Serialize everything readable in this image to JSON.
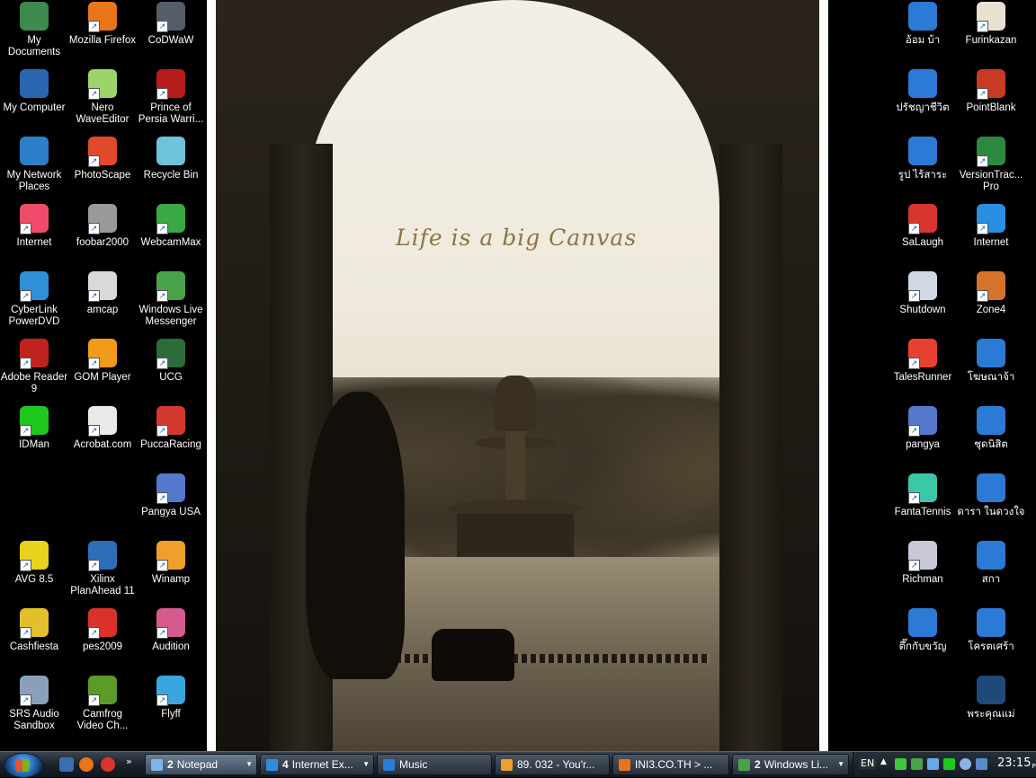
{
  "wallpaper": {
    "caption": "Life is a big Canvas"
  },
  "left_icons": [
    {
      "label": "My Documents",
      "icon": "folder-documents-icon",
      "color": "#3d8a4e"
    },
    {
      "label": "Mozilla Firefox",
      "icon": "firefox-icon",
      "color": "#e8751a"
    },
    {
      "label": "CoDWaW",
      "icon": "codwaw-icon",
      "color": "#555e68"
    },
    {
      "label": "My Computer",
      "icon": "computer-icon",
      "color": "#2a66b0"
    },
    {
      "label": "Nero WaveEditor",
      "icon": "nero-icon",
      "color": "#9ed36a"
    },
    {
      "label": "Prince of Persia Warri...",
      "icon": "prince-of-persia-icon",
      "color": "#b71c1c"
    },
    {
      "label": "My Network Places",
      "icon": "network-icon",
      "color": "#2b7fc8"
    },
    {
      "label": "PhotoScape",
      "icon": "photoscape-icon",
      "color": "#e04a2b"
    },
    {
      "label": "Recycle Bin",
      "icon": "recycle-bin-icon",
      "color": "#6fc3d9"
    },
    {
      "label": "Internet",
      "icon": "hello-kitty-icon",
      "color": "#f04c6a"
    },
    {
      "label": "foobar2000",
      "icon": "foobar-icon",
      "color": "#999999"
    },
    {
      "label": "WebcamMax",
      "icon": "webcam-icon",
      "color": "#3aa843"
    },
    {
      "label": "CyberLink PowerDVD",
      "icon": "powerdvd-icon",
      "color": "#2f8fd8"
    },
    {
      "label": "amcap",
      "icon": "amcap-icon",
      "color": "#d9d9d9"
    },
    {
      "label": "Windows Live Messenger",
      "icon": "messenger-icon",
      "color": "#4aa34a"
    },
    {
      "label": "Adobe Reader 9",
      "icon": "adobe-reader-icon",
      "color": "#c0231e"
    },
    {
      "label": "GOM Player",
      "icon": "gom-player-icon",
      "color": "#f29a1a"
    },
    {
      "label": "UCG",
      "icon": "ucg-icon",
      "color": "#2e6b3a"
    },
    {
      "label": "IDMan",
      "icon": "idman-icon",
      "color": "#1ec81e"
    },
    {
      "label": "Acrobat.com",
      "icon": "acrobat-icon",
      "color": "#e9e9e9"
    },
    {
      "label": "PuccaRacing",
      "icon": "pucca-racing-icon",
      "color": "#d33a2e"
    },
    {
      "label": "Pangya USA",
      "icon": "pangya-usa-icon",
      "color": "#5577cc"
    },
    {
      "label": "AVG 8.5",
      "icon": "avg-icon",
      "color": "#e8d21e"
    },
    {
      "label": "Xilinx PlanAhead 11",
      "icon": "xilinx-icon",
      "color": "#2c6fb8"
    },
    {
      "label": "Winamp",
      "icon": "winamp-icon",
      "color": "#f0a02a"
    },
    {
      "label": "Cashfiesta",
      "icon": "cashfiesta-icon",
      "color": "#e3c02a"
    },
    {
      "label": "pes2009",
      "icon": "pes2009-icon",
      "color": "#d9322a"
    },
    {
      "label": "Audition",
      "icon": "audition-icon",
      "color": "#d55a90"
    },
    {
      "label": "SRS Audio Sandbox",
      "icon": "srs-audio-icon",
      "color": "#8aa0b8"
    },
    {
      "label": "Camfrog Video Ch...",
      "icon": "camfrog-icon",
      "color": "#5c9a2a"
    },
    {
      "label": "Flyff",
      "icon": "flyff-icon",
      "color": "#3aa6e0"
    }
  ],
  "right_icons": [
    {
      "label": "อ้อม บ้า",
      "icon": "folder-icon",
      "color": "#2b7ad6"
    },
    {
      "label": "Furinkazan",
      "icon": "furinkazan-icon",
      "color": "#e9e0d0"
    },
    {
      "label": "ปรัชญาชีวิต",
      "icon": "folder-icon",
      "color": "#2b7ad6"
    },
    {
      "label": "PointBlank",
      "icon": "pointblank-icon",
      "color": "#c83a22"
    },
    {
      "label": "รูป ไร้สาระ",
      "icon": "folder-icon",
      "color": "#2b7ad6"
    },
    {
      "label": "VersionTrac... Pro",
      "icon": "versiontracker-icon",
      "color": "#2c8a3e"
    },
    {
      "label": "SaLaugh",
      "icon": "salaugh-icon",
      "color": "#d8352e"
    },
    {
      "label": "Internet",
      "icon": "internet-explorer-icon",
      "color": "#2a8fe0"
    },
    {
      "label": "Shutdown",
      "icon": "shutdown-icon",
      "color": "#cfd8e4"
    },
    {
      "label": "Zone4",
      "icon": "zone4-icon",
      "color": "#d5732a"
    },
    {
      "label": "TalesRunner",
      "icon": "talesrunner-icon",
      "color": "#e8412f"
    },
    {
      "label": "โฆษณาจ้า",
      "icon": "folder-icon",
      "color": "#2b7ad6"
    },
    {
      "label": "pangya",
      "icon": "pangya-icon",
      "color": "#5577cc"
    },
    {
      "label": "ชุดนิสิต",
      "icon": "folder-icon",
      "color": "#2b7ad6"
    },
    {
      "label": "FantaTennis",
      "icon": "fantatennis-icon",
      "color": "#3ac8a8"
    },
    {
      "label": "ดารา ในดวงใจ",
      "icon": "folder-icon",
      "color": "#2b7ad6"
    },
    {
      "label": "Richman",
      "icon": "richman-icon",
      "color": "#c8c8d8"
    },
    {
      "label": "สกา",
      "icon": "folder-icon",
      "color": "#2b7ad6"
    },
    {
      "label": "ตึ๊กกับขวัญ",
      "icon": "folder-icon",
      "color": "#2b7ad6"
    },
    {
      "label": "โครตเศร้า",
      "icon": "folder-icon",
      "color": "#2b7ad6"
    },
    {
      "label": "พระคุณแม่",
      "icon": "media-file-icon",
      "color": "#1e4a7a"
    }
  ],
  "taskbar": {
    "more_glyph": "»",
    "tasks": [
      {
        "count": "2",
        "label": "Notepad",
        "has_arrow": true,
        "icon_color": "#7fb6ea"
      },
      {
        "count": "4",
        "label": "Internet Ex...",
        "has_arrow": true,
        "icon_color": "#2a8fe0"
      },
      {
        "count": "",
        "label": "Music",
        "has_arrow": false,
        "icon_color": "#2b7ad6"
      },
      {
        "count": "",
        "label": "89. 032 - You'r...",
        "has_arrow": false,
        "icon_color": "#f0a02a"
      },
      {
        "count": "",
        "label": "INI3.CO.TH > ...",
        "has_arrow": false,
        "icon_color": "#e8751a"
      },
      {
        "count": "2",
        "label": "Windows Li...",
        "has_arrow": true,
        "icon_color": "#4aa34a"
      }
    ],
    "tray": {
      "language": "EN",
      "time": "23:15",
      "meridiem": "PM"
    }
  }
}
